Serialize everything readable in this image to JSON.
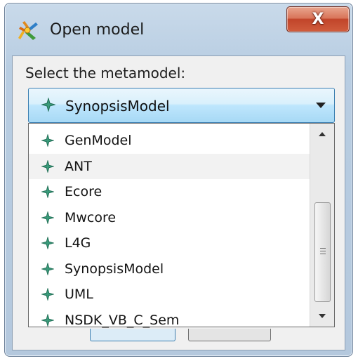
{
  "window": {
    "title": "Open model",
    "close_label": "X"
  },
  "dialog": {
    "prompt": "Select the metamodel:",
    "selected": "SynopsisModel",
    "options": [
      {
        "label": "GenModel"
      },
      {
        "label": "ANT"
      },
      {
        "label": "Ecore"
      },
      {
        "label": "Mwcore"
      },
      {
        "label": "L4G"
      },
      {
        "label": "SynopsisModel"
      },
      {
        "label": "UML"
      },
      {
        "label": "NSDK_VB_C_Sem"
      }
    ],
    "highlighted_option": "ANT"
  },
  "icons": {
    "app": "open-model-app-icon",
    "option": "metamodel-diamond-icon",
    "dropdown": "chevron-down-icon"
  },
  "colors": {
    "accent_border": "#3c7fb1",
    "option_icon": "#2e8b6b",
    "close_button": "#c1452a"
  }
}
